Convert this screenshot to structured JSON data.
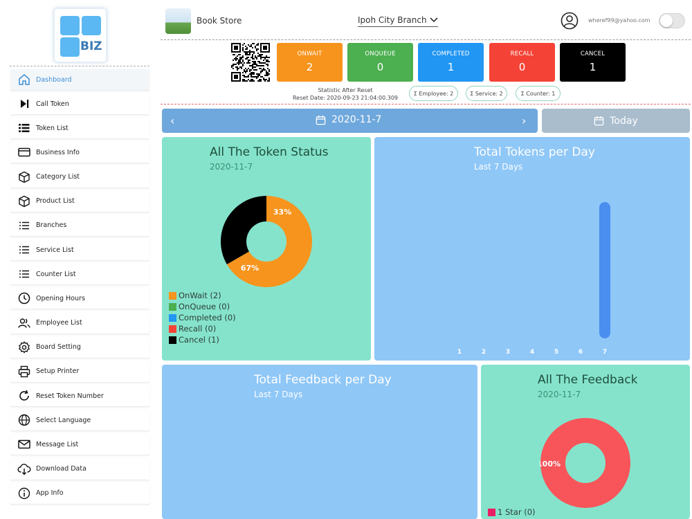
{
  "sidebar": {
    "logo_text": "BIZ",
    "items": [
      {
        "label": "Dashboard",
        "icon": "home-icon"
      },
      {
        "label": "Call Token",
        "icon": "play-skip-icon"
      },
      {
        "label": "Token List",
        "icon": "list-bullet-icon"
      },
      {
        "label": "Business Info",
        "icon": "card-icon"
      },
      {
        "label": "Category List",
        "icon": "box-icon"
      },
      {
        "label": "Product List",
        "icon": "box-icon"
      },
      {
        "label": "Branches",
        "icon": "list-icon"
      },
      {
        "label": "Service List",
        "icon": "list-icon"
      },
      {
        "label": "Counter List",
        "icon": "list-icon"
      },
      {
        "label": "Opening Hours",
        "icon": "clock-icon"
      },
      {
        "label": "Employee List",
        "icon": "people-icon"
      },
      {
        "label": "Board Setting",
        "icon": "gear-icon"
      },
      {
        "label": "Setup Printer",
        "icon": "printer-icon"
      },
      {
        "label": "Reset Token Number",
        "icon": "refresh-icon"
      },
      {
        "label": "Select Language",
        "icon": "globe-icon"
      },
      {
        "label": "Message List",
        "icon": "mail-icon"
      },
      {
        "label": "Download Data",
        "icon": "download-icon"
      },
      {
        "label": "App Info",
        "icon": "info-icon"
      }
    ]
  },
  "header": {
    "store_name": "Book Store",
    "branch": "Ipoh City Branch",
    "user_email": "wheref99@yahoo.com"
  },
  "stats": [
    {
      "label": "ONWAIT",
      "value": "2",
      "color": "#f7941d"
    },
    {
      "label": "ONQUEUE",
      "value": "0",
      "color": "#4caf50"
    },
    {
      "label": "COMPLETED",
      "value": "1",
      "color": "#2196f3"
    },
    {
      "label": "RECALL",
      "value": "0",
      "color": "#f44336"
    },
    {
      "label": "CANCEL",
      "value": "1",
      "color": "#000000"
    }
  ],
  "reset": {
    "line1": "Statistic After Reset",
    "line2": "Reset Date: 2020-09-23 21:04:00.309"
  },
  "pills": {
    "employee": "Σ Employee: 2",
    "service": "Σ Service: 2",
    "counter": "Σ Counter: 1"
  },
  "datebar": {
    "date": "2020-11-7",
    "today_label": "Today"
  },
  "token_status": {
    "title": "All The Token Status",
    "subtitle": "2020-11-7",
    "label_a": "33%",
    "label_b": "67%",
    "legend": [
      {
        "label": "OnWait (2)",
        "color": "#f7941d"
      },
      {
        "label": "OnQueue (0)",
        "color": "#4caf50"
      },
      {
        "label": "Completed (0)",
        "color": "#2196f3"
      },
      {
        "label": "Recall (0)",
        "color": "#f44336"
      },
      {
        "label": "Cancel (1)",
        "color": "#000000"
      }
    ]
  },
  "tokens_per_day": {
    "title": "Total Tokens per Day",
    "subtitle": "Last 7 Days"
  },
  "feedback_per_day": {
    "title": "Total Feedback per Day",
    "subtitle": "Last 7 Days"
  },
  "all_feedback": {
    "title": "All The Feedback",
    "subtitle": "2020-11-7",
    "label": "100%",
    "legend": [
      {
        "label": "1 Star (0)",
        "color": "#e91e63"
      }
    ]
  },
  "chart_data": [
    {
      "type": "pie",
      "title": "All The Token Status",
      "subtitle": "2020-11-7",
      "categories": [
        "OnWait",
        "OnQueue",
        "Completed",
        "Recall",
        "Cancel"
      ],
      "values": [
        2,
        0,
        0,
        0,
        1
      ],
      "data_labels": [
        "67%",
        "",
        "",
        "",
        "33%"
      ],
      "colors": [
        "#f7941d",
        "#4caf50",
        "#2196f3",
        "#f44336",
        "#000000"
      ],
      "legend": "bottom-left",
      "donut": true
    },
    {
      "type": "bar",
      "title": "Total Tokens per Day",
      "subtitle": "Last 7 Days",
      "categories": [
        "1",
        "2",
        "3",
        "4",
        "5",
        "6",
        "7"
      ],
      "values": [
        0,
        0,
        0,
        0,
        0,
        0,
        3
      ],
      "color": "#4a8ef0",
      "grid": false
    },
    {
      "type": "bar",
      "title": "Total Feedback per Day",
      "subtitle": "Last 7 Days",
      "categories": [],
      "values": []
    },
    {
      "type": "pie",
      "title": "All The Feedback",
      "subtitle": "2020-11-7",
      "categories": [
        "1 Star"
      ],
      "values": [
        1
      ],
      "data_labels": [
        "100%"
      ],
      "colors": [
        "#f7555a"
      ],
      "legend": "bottom-left",
      "donut": true
    }
  ]
}
